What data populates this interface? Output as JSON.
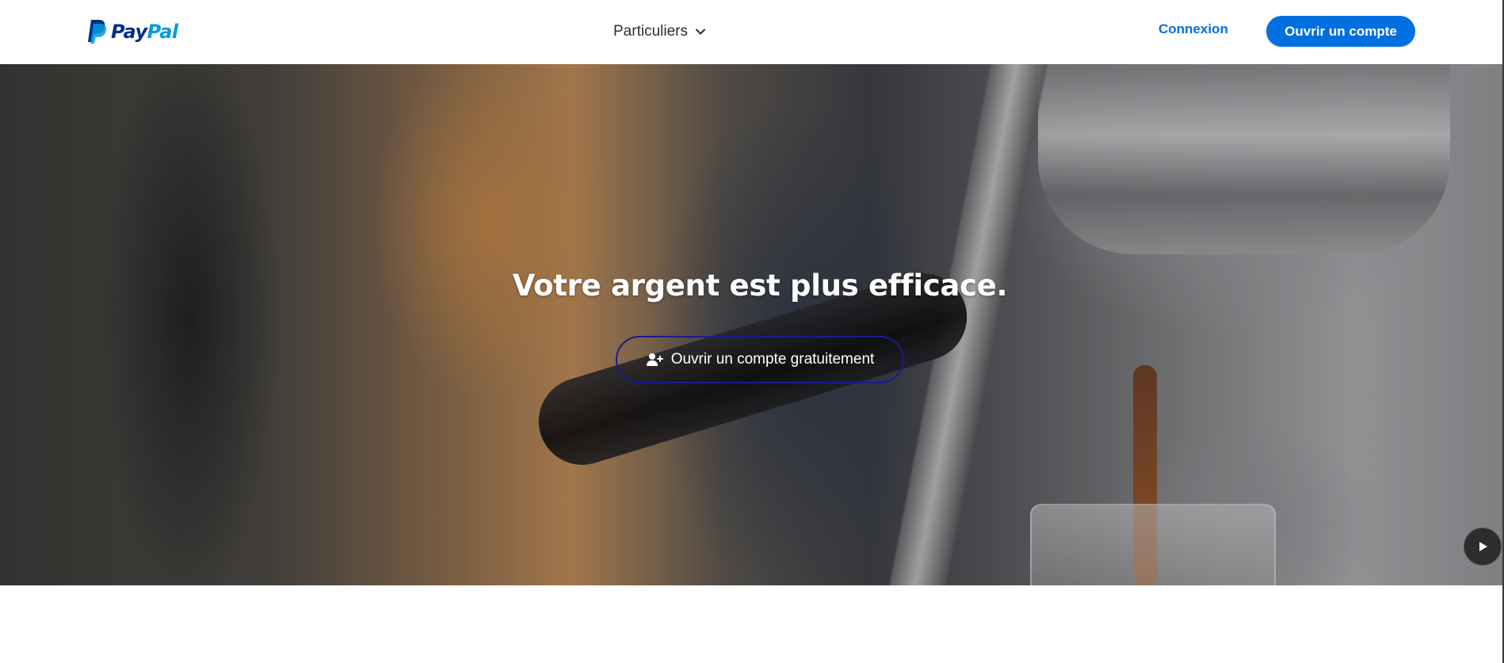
{
  "header": {
    "logo": {
      "text_pay": "Pay",
      "text_pal": "Pal"
    },
    "nav_menu_label": "Particuliers",
    "login_label": "Connexion",
    "signup_label": "Ouvrir un compte"
  },
  "hero": {
    "title": "Votre argent est plus efficace.",
    "cta_label": "Ouvrir un compte gratuitement"
  },
  "colors": {
    "brand_blue": "#0070e0",
    "logo_dark_blue": "#003087",
    "logo_light_blue": "#009cde",
    "cta_border": "#1b1a8f"
  },
  "icons": [
    "paypal-logo-icon",
    "chevron-down-icon",
    "user-plus-icon",
    "play-icon"
  ]
}
